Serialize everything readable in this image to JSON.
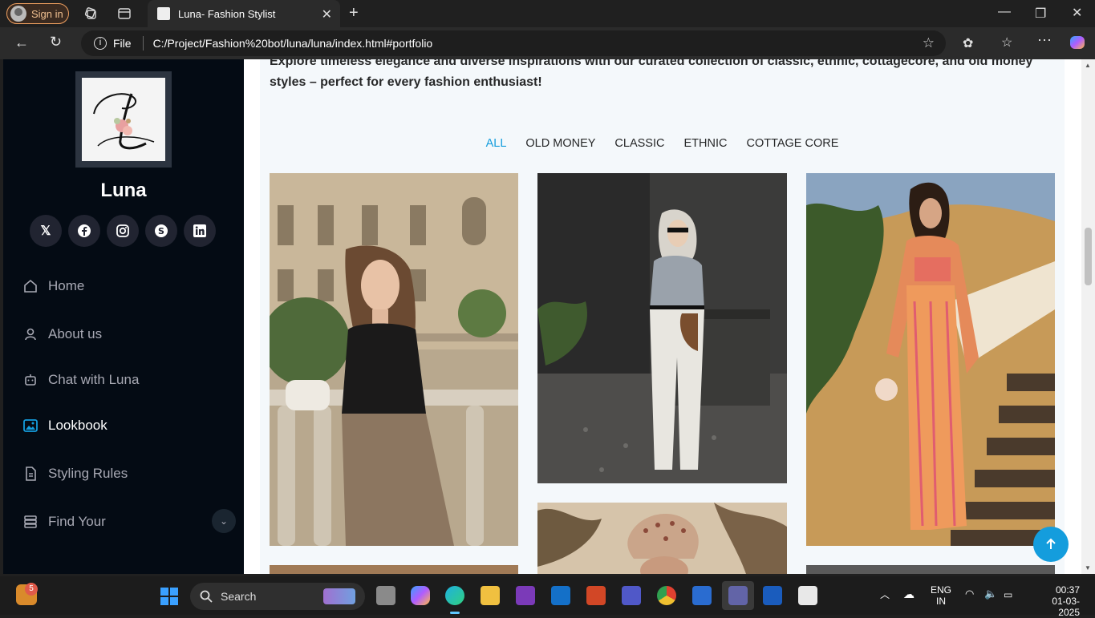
{
  "browser": {
    "signin_label": "Sign in",
    "tab_title": "Luna- Fashion Stylist",
    "url_scheme": "File",
    "url": "C:/Project/Fashion%20bot/luna/luna/index.html#portfolio"
  },
  "sidebar": {
    "site_name": "Luna",
    "socials": [
      "twitter-x-icon",
      "facebook-icon",
      "instagram-icon",
      "skype-icon",
      "linkedin-icon"
    ],
    "nav": [
      {
        "label": "Home",
        "icon": "home-icon"
      },
      {
        "label": "About us",
        "icon": "user-icon"
      },
      {
        "label": "Chat with Luna",
        "icon": "robot-icon"
      },
      {
        "label": "Lookbook",
        "icon": "images-icon",
        "active": true
      },
      {
        "label": "Styling Rules",
        "icon": "document-icon"
      },
      {
        "label": "Find Your",
        "icon": "list-icon",
        "has_dropdown": true
      }
    ]
  },
  "portfolio": {
    "intro": "Explore timeless elegance and diverse inspirations with our curated collection of classic, ethnic, cottagecore, and old money styles – perfect for every fashion enthusiast!",
    "filters": [
      "ALL",
      "OLD MONEY",
      "CLASSIC",
      "ETHNIC",
      "COTTAGE CORE"
    ],
    "active_filter": "ALL"
  },
  "taskbar": {
    "search_placeholder": "Search",
    "notification_count": "5",
    "lang_top": "ENG",
    "lang_bottom": "IN",
    "time": "00:37",
    "date": "01-03-2025"
  },
  "colors": {
    "accent": "#149ddd",
    "sidebar_bg": "#040b14",
    "section_bg": "#f4f8fb"
  }
}
